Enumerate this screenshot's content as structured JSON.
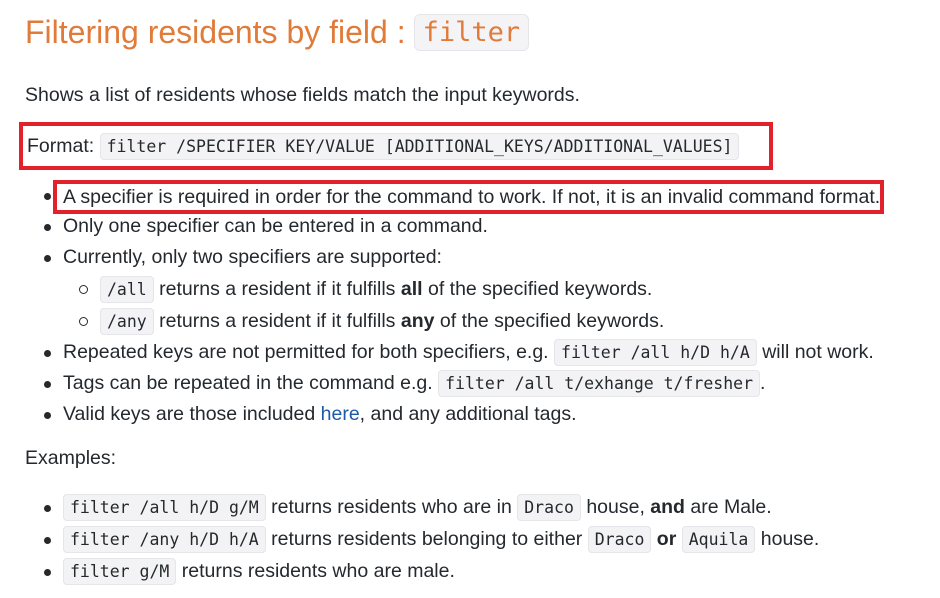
{
  "title": {
    "text": "Filtering residents by field :",
    "code": "filter"
  },
  "intro": "Shows a list of residents whose fields match the input keywords.",
  "format": {
    "label": "Format:",
    "code": "filter /SPECIFIER KEY/VALUE [ADDITIONAL_KEYS/ADDITIONAL_VALUES]"
  },
  "rules": {
    "r1": "A specifier is required in order for the command to work. If not, it is an invalid command format.",
    "r2": "Only one specifier can be entered in a command.",
    "r3": "Currently, only two specifiers are supported:",
    "sub1": {
      "code": "/all",
      "pre": "returns a resident if it fulfills",
      "bold": "all",
      "post": "of the specified keywords."
    },
    "sub2": {
      "code": "/any",
      "pre": "returns a resident if it fulfills",
      "bold": "any",
      "post": "of the specified keywords."
    },
    "r4": {
      "pre": "Repeated keys are not permitted for both specifiers, e.g.",
      "code": "filter /all h/D h/A",
      "post": "will not work."
    },
    "r5": {
      "pre": "Tags can be repeated in the command e.g.",
      "code": "filter /all t/exhange t/fresher",
      "post": "."
    },
    "r6": {
      "pre": "Valid keys are those included",
      "link": "here",
      "post": ", and any additional tags."
    }
  },
  "examples_label": "Examples:",
  "examples": {
    "e1": {
      "code": "filter /all h/D g/M",
      "t1": "returns residents who are in",
      "c2": "Draco",
      "t2": "house,",
      "bold": "and",
      "t3": "are Male."
    },
    "e2": {
      "code": "filter /any h/D h/A",
      "t1": "returns residents belonging to either",
      "c2": "Draco",
      "bold": "or",
      "c3": "Aquila",
      "t2": "house."
    },
    "e3": {
      "code": "filter g/M",
      "t1": "returns residents who are male."
    }
  },
  "colors": {
    "heading": "#e07b39",
    "highlight_border": "#e2222b",
    "link": "#1e5aa8"
  }
}
